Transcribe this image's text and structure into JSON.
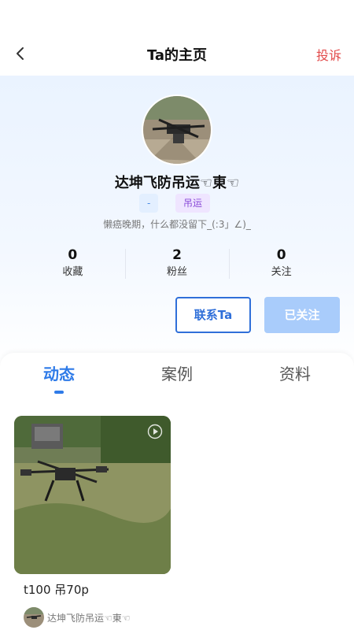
{
  "header": {
    "title": "Ta的主页",
    "report_label": "投诉"
  },
  "profile": {
    "name": "达坤飞防吊运☜東☜",
    "tags": [
      "-",
      "吊运"
    ],
    "bio": "懒癌晚期，什么都没留下_(:3」∠)_"
  },
  "stats": [
    {
      "value": "0",
      "label": "收藏"
    },
    {
      "value": "2",
      "label": "粉丝"
    },
    {
      "value": "0",
      "label": "关注"
    }
  ],
  "actions": {
    "contact_label": "联系Ta",
    "followed_label": "已关注"
  },
  "tabs": [
    {
      "label": "动态",
      "active": true
    },
    {
      "label": "案例",
      "active": false
    },
    {
      "label": "资料",
      "active": false
    }
  ],
  "posts": [
    {
      "caption": "t100 吊70p",
      "author": "达坤飞防吊运☜東☜",
      "type": "video",
      "icon": "play-icon"
    }
  ],
  "colors": {
    "accent": "#2f7be8",
    "report": "#e24a4a",
    "followed_bg": "#a9ccfb"
  }
}
